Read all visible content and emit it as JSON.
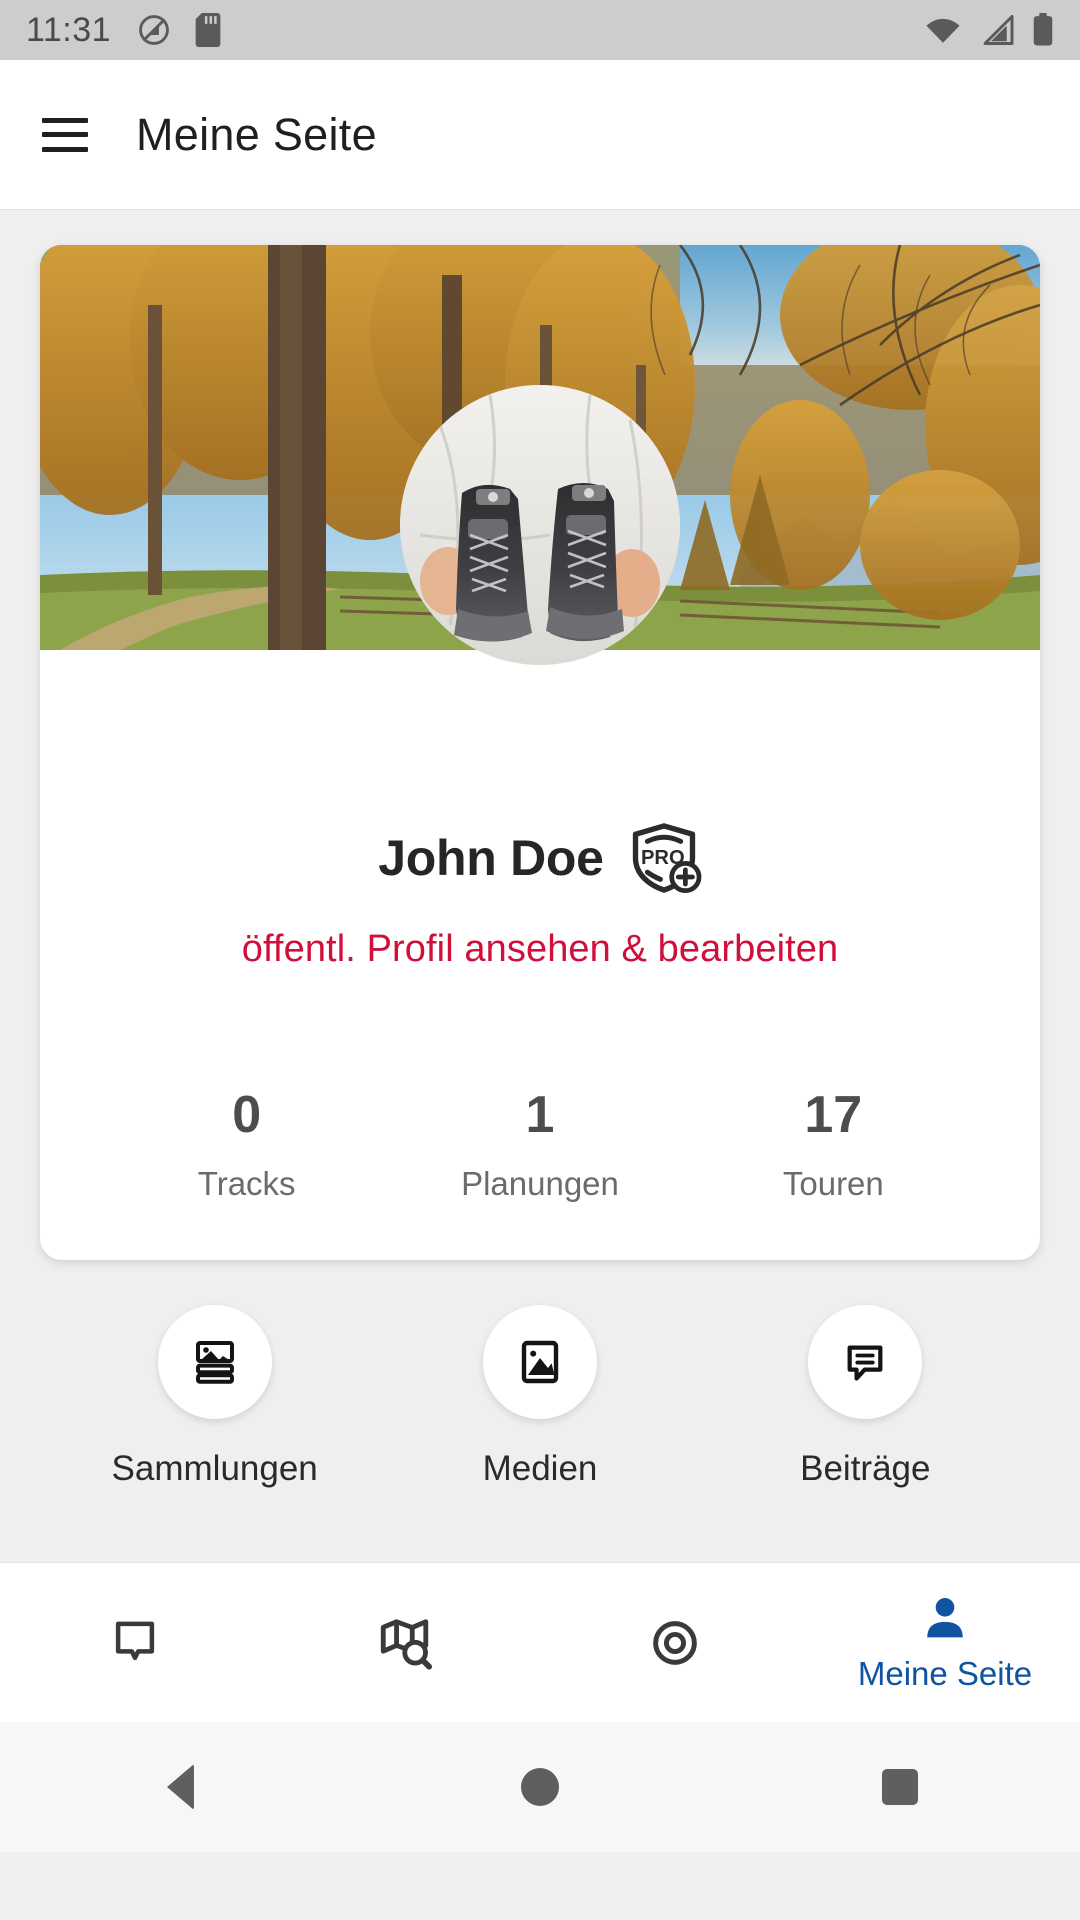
{
  "status_bar": {
    "time": "11:31",
    "left_icons": [
      "do-not-disturb-icon",
      "sd-card-icon"
    ],
    "right_icons": [
      "wifi-icon",
      "cellular-signal-icon",
      "battery-icon"
    ],
    "background": "#cdcdcd"
  },
  "app_bar": {
    "menu_icon": "hamburger-menu-icon",
    "title": "Meine Seite"
  },
  "profile": {
    "cover_photo_alt": "autumn larch forest with blue sky and mountain view",
    "avatar_alt": "hands holding grey hiking boots against white sweater",
    "name": "John Doe",
    "badge": "pro-plus-badge",
    "badge_text": "PRO",
    "profile_link": "öffentl. Profil ansehen & bearbeiten",
    "link_color": "#d0103a",
    "stats": [
      {
        "value": "0",
        "label": "Tracks"
      },
      {
        "value": "1",
        "label": "Planungen"
      },
      {
        "value": "17",
        "label": "Touren"
      }
    ]
  },
  "actions": [
    {
      "label": "Sammlungen",
      "icon": "collections-icon"
    },
    {
      "label": "Medien",
      "icon": "image-icon"
    },
    {
      "label": "Beiträge",
      "icon": "chat-bubble-icon"
    }
  ],
  "bottom_nav": {
    "active_color": "#1053a0",
    "inactive_color": "#3a3a3a",
    "items": [
      {
        "icon": "tooltip-icon",
        "label": "",
        "active": false
      },
      {
        "icon": "map-search-icon",
        "label": "",
        "active": false
      },
      {
        "icon": "record-target-icon",
        "label": "",
        "active": false
      },
      {
        "icon": "person-icon",
        "label": "Meine Seite",
        "active": true
      }
    ]
  },
  "android_nav": {
    "back": "back-triangle-icon",
    "home": "home-circle-icon",
    "recents": "recents-square-icon"
  }
}
